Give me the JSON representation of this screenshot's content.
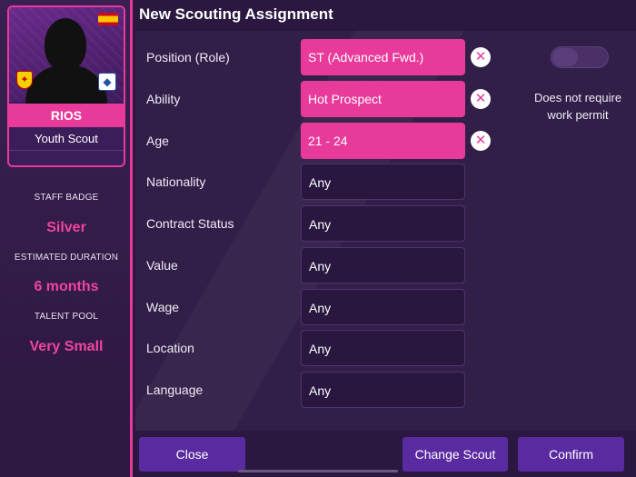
{
  "sidebar": {
    "scout": {
      "name": "RIOS",
      "role": "Youth Scout"
    },
    "stats": [
      {
        "label": "STAFF BADGE",
        "value": "Silver"
      },
      {
        "label": "ESTIMATED DURATION",
        "value": "6 months"
      },
      {
        "label": "TALENT POOL",
        "value": "Very Small"
      }
    ]
  },
  "main": {
    "title": "New Scouting Assignment",
    "filters": [
      {
        "label": "Position (Role)",
        "value": "ST (Advanced Fwd.)",
        "active": true
      },
      {
        "label": "Ability",
        "value": "Hot Prospect",
        "active": true
      },
      {
        "label": "Age",
        "value": "21 - 24",
        "active": true
      },
      {
        "label": "Nationality",
        "value": "Any",
        "active": false
      },
      {
        "label": "Contract Status",
        "value": "Any",
        "active": false
      },
      {
        "label": "Value",
        "value": "Any",
        "active": false
      },
      {
        "label": "Wage",
        "value": "Any",
        "active": false
      },
      {
        "label": "Location",
        "value": "Any",
        "active": false
      },
      {
        "label": "Language",
        "value": "Any",
        "active": false
      }
    ],
    "work_permit": {
      "label": "Does not require work permit",
      "enabled": false
    }
  },
  "footer": {
    "close": "Close",
    "change_scout": "Change Scout",
    "confirm": "Confirm"
  },
  "colors": {
    "accent": "#e83a9a",
    "button": "#5a2aa0",
    "background": "#2a1840"
  }
}
